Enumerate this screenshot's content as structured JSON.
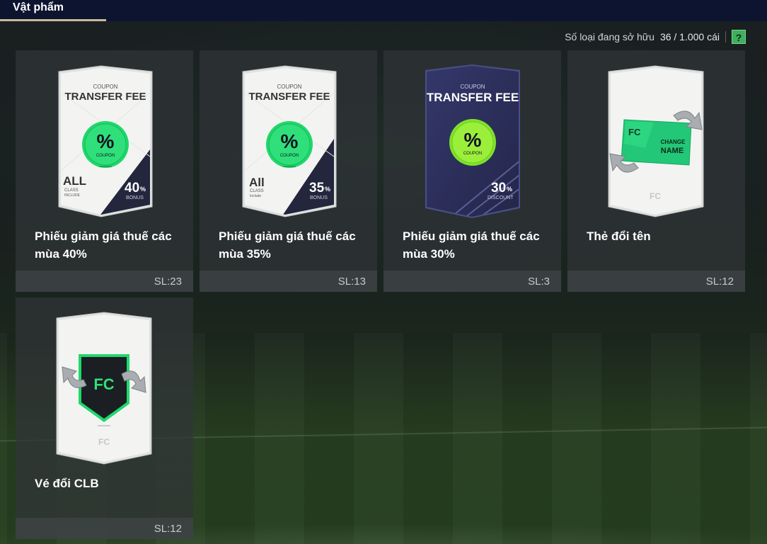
{
  "header": {
    "active_tab": "Vật phẩm"
  },
  "inventory": {
    "label": "Số loại đang sở hữu",
    "value": "36 / 1.000 cái",
    "help": "?"
  },
  "items": [
    {
      "name": "Phiếu giảm giá thuế các mùa 40%",
      "qty": "SL:23",
      "card": {
        "top": "COUPON",
        "title": "TRANSFER FEE",
        "badge_big": "%",
        "badge_small": "COUPON",
        "class_big": "ALL",
        "class_small1": "CLASS",
        "class_small2": "INCLUDE",
        "pct": "40",
        "pct_unit": "%",
        "pct_label": "BONUS"
      }
    },
    {
      "name": "Phiếu giảm giá thuế các mùa 35%",
      "qty": "SL:13",
      "card": {
        "top": "COUPON",
        "title": "TRANSFER FEE",
        "badge_big": "%",
        "badge_small": "COUPON",
        "class_big": "All",
        "class_small1": "CLASS",
        "class_small2": "Include",
        "pct": "35",
        "pct_unit": "%",
        "pct_label": "BONUS"
      }
    },
    {
      "name": "Phiếu giảm giá thuế các mùa 30%",
      "qty": "SL:3",
      "card": {
        "top": "COUPON",
        "title": "TRANSFER FEE",
        "badge_big": "%",
        "badge_small": "COUPON",
        "pct": "30",
        "pct_unit": "%",
        "pct_label": "DISCOUNT"
      }
    },
    {
      "name": "Thẻ đổi tên",
      "qty": "SL:12",
      "card": {
        "ticket_line1": "CHANGE",
        "ticket_line2": "NAME"
      }
    },
    {
      "name": "Vé đổi CLB",
      "qty": "SL:12"
    }
  ],
  "colors": {
    "topbar": "#0d1430",
    "tab_underline": "#c9b99a",
    "accent_green": "#2fe07a",
    "dark_card": "#2c2f52",
    "help_green": "#3fae5e"
  },
  "icons": [
    "coupon-badge-icon",
    "change-name-ticket-icon",
    "club-crest-icon",
    "fc-logo-icon",
    "swap-arrows-icon"
  ]
}
